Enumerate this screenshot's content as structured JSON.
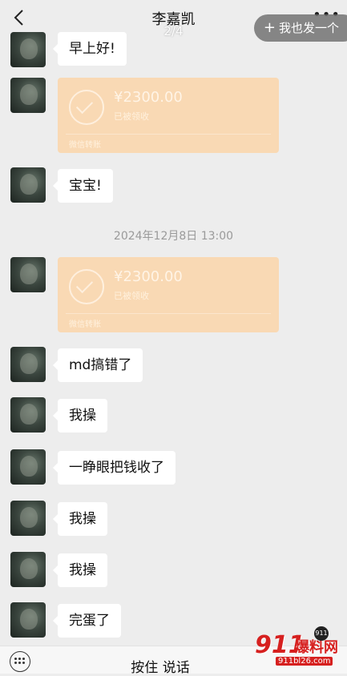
{
  "header": {
    "title": "李嘉凯",
    "page_indicator": "2/4",
    "more_label": "•••",
    "post_button_label": "我也发一个",
    "post_button_plus": "+"
  },
  "messages": [
    {
      "type": "text",
      "text": "早上好!"
    },
    {
      "type": "transfer",
      "amount": "¥2300.00",
      "status": "已被领收",
      "footer": "微信转账"
    },
    {
      "type": "text",
      "text": "宝宝!"
    },
    {
      "type": "timestamp",
      "text": "2024年12月8日 13:00"
    },
    {
      "type": "transfer",
      "amount": "¥2300.00",
      "status": "已被领收",
      "footer": "微信转账"
    },
    {
      "type": "text",
      "text": "md搞错了"
    },
    {
      "type": "text",
      "text": "我操"
    },
    {
      "type": "text",
      "text": "一睁眼把钱收了"
    },
    {
      "type": "text",
      "text": "我操"
    },
    {
      "type": "text",
      "text": "我操"
    },
    {
      "type": "text",
      "text": "完蛋了"
    }
  ],
  "bottom": {
    "voice_label": "按住 说话"
  },
  "watermark": {
    "number": "911",
    "text": "爆料网",
    "url": "911bl26.com",
    "badge": "911"
  },
  "colors": {
    "background": "#ededed",
    "transfer_bubble": "#f9d9b4",
    "watermark_red": "#d6201f"
  }
}
